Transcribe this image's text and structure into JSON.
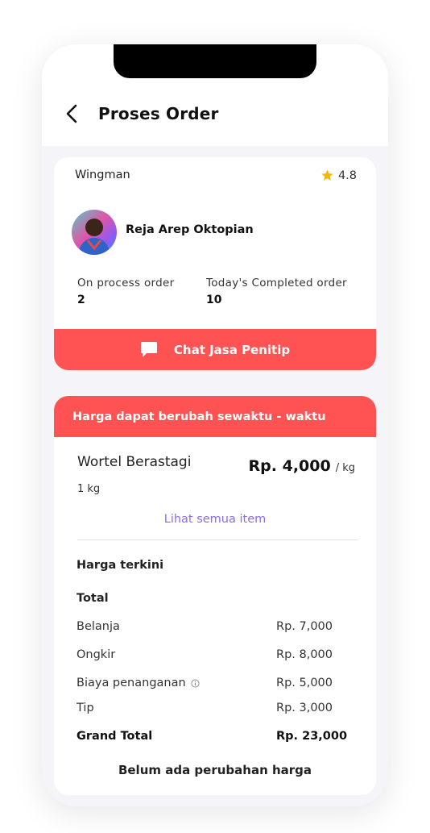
{
  "header": {
    "title": "Proses Order",
    "back_icon": "chevron-left-icon"
  },
  "driver_card": {
    "role": "Wingman",
    "rating": "4.8",
    "name": "Reja Arep Oktopian",
    "stats": [
      {
        "label": "On process order",
        "value": "2"
      },
      {
        "label": "Today's Completed order",
        "value": "10"
      }
    ],
    "chat_button": "Chat Jasa Penitip",
    "accent": "#ff5252",
    "star_color": "#f5b800"
  },
  "order_card": {
    "banner": "Harga dapat berubah sewaktu - waktu",
    "item": {
      "name": "Wortel Berastagi",
      "price": "Rp. 4,000",
      "unit": "/ kg",
      "qty": "1 kg"
    },
    "see_all": "Lihat semua item",
    "current_price_title": "Harga terkini",
    "total_title": "Total",
    "rows": [
      {
        "label": "Belanja",
        "value": "Rp. 7,000"
      },
      {
        "label": "Ongkir",
        "value": "Rp. 8,000"
      },
      {
        "label": "Biaya penanganan",
        "value": "Rp. 5,000"
      },
      {
        "label": "Tip",
        "value": "Rp. 3,000"
      }
    ],
    "grand_total": {
      "label": "Grand Total",
      "value": "Rp. 23,000"
    },
    "status": "Belum ada perubahan harga",
    "link_color": "#8a6cf0"
  }
}
